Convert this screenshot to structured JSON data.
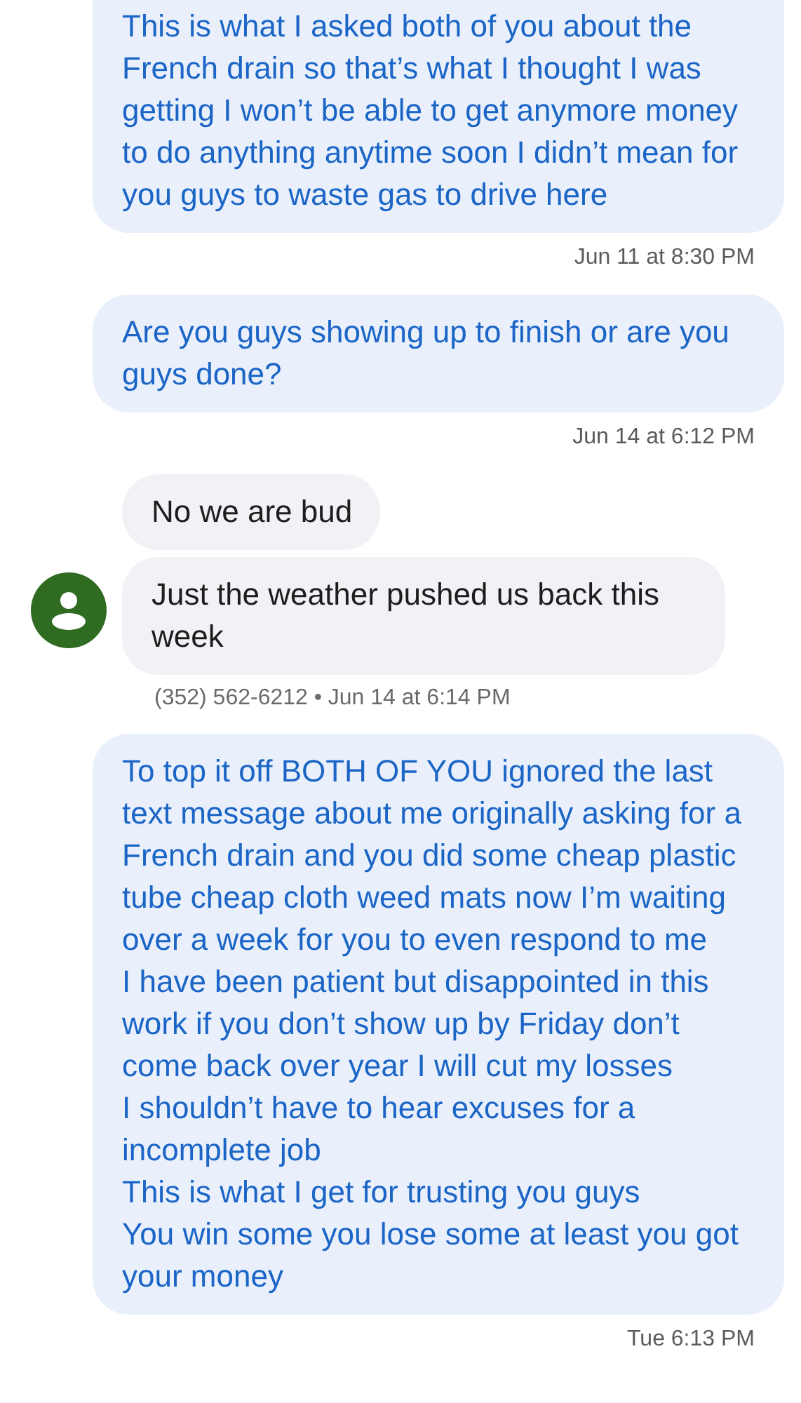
{
  "groups": [
    {
      "kind": "outgoing",
      "messages": [
        "This is what I asked both of you about the French drain so that’s what I thought I was getting I won’t be able to get anymore money to do anything anytime soon I didn’t mean for you guys to waste gas to drive here"
      ],
      "meta": "Jun 11 at 8:30 PM"
    },
    {
      "kind": "outgoing",
      "messages": [
        "Are you guys showing up to finish or are you guys done?"
      ],
      "meta": "Jun 14 at 6:12 PM"
    },
    {
      "kind": "incoming",
      "messages": [
        "No we are bud",
        "Just the weather pushed us back this week"
      ],
      "meta": "(352) 562-6212 • Jun 14 at 6:14 PM"
    },
    {
      "kind": "outgoing",
      "messages": [
        "To top it off BOTH OF YOU ignored the last text message about me originally asking for a French drain and you did some cheap plastic tube cheap cloth weed mats now I’m waiting over a week for you to even respond to me\nI have been patient but disappointed in this work if you don’t show up by Friday don’t come back over year I will cut my losses\nI shouldn’t have to hear excuses for a incomplete job\nThis is what I get for trusting you guys\nYou win some you lose some at least you got your money"
      ],
      "meta": "Tue 6:13 PM"
    }
  ]
}
